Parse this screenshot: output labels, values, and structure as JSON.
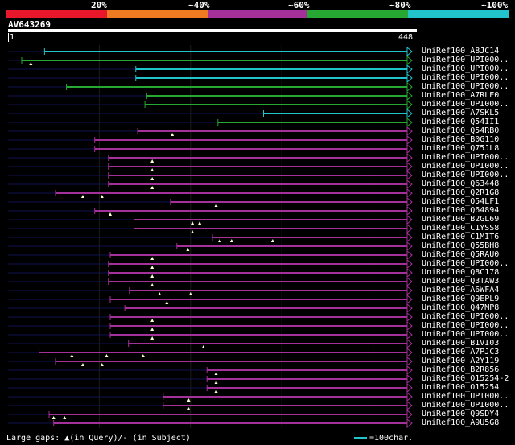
{
  "scale": {
    "ticks": [
      "20%",
      "~40%",
      "~60%",
      "~80%",
      "~100%"
    ],
    "colors": [
      "#e8172b",
      "#ee7b22",
      "#a43099",
      "#26a833",
      "#22c4cc"
    ]
  },
  "query": {
    "name": "AV643269",
    "start": "1",
    "end": "448",
    "length": 448
  },
  "legend": {
    "prefix": "Large gaps: ",
    "query_text": "(in Query)/- (in Subject)",
    "scale_text": "=100char."
  },
  "hits": [
    {
      "name": "UniRef100_A8JC14",
      "start": 40,
      "end": 465,
      "color": "cyan",
      "tri": []
    },
    {
      "name": "UniRef100_UPI000..",
      "start": 15,
      "end": 500,
      "color": "green",
      "tri": [
        25
      ]
    },
    {
      "name": "UniRef100_UPI000..",
      "start": 140,
      "end": 500,
      "color": "cyan",
      "tri": []
    },
    {
      "name": "UniRef100_UPI000..",
      "start": 140,
      "end": 500,
      "color": "cyan",
      "tri": []
    },
    {
      "name": "UniRef100_UPI000..",
      "start": 64,
      "end": 500,
      "color": "green",
      "tri": []
    },
    {
      "name": "UniRef100_A7RLE0",
      "start": 152,
      "end": 500,
      "color": "green",
      "tri": []
    },
    {
      "name": "UniRef100_UPI000..",
      "start": 150,
      "end": 500,
      "color": "green",
      "tri": []
    },
    {
      "name": "UniRef100_A7SKL5",
      "start": 280,
      "end": 500,
      "color": "cyan",
      "tri": []
    },
    {
      "name": "UniRef100_Q54II1",
      "start": 230,
      "end": 500,
      "color": "green",
      "tri": []
    },
    {
      "name": "UniRef100_Q54RB0",
      "start": 142,
      "end": 500,
      "color": "purple",
      "tri": [
        180
      ]
    },
    {
      "name": "UniRef100_B0G110",
      "start": 95,
      "end": 500,
      "color": "purple",
      "tri": []
    },
    {
      "name": "UniRef100_Q75JL8",
      "start": 95,
      "end": 500,
      "color": "purple",
      "tri": []
    },
    {
      "name": "UniRef100_UPI000..",
      "start": 110,
      "end": 500,
      "color": "purple",
      "tri": [
        158
      ]
    },
    {
      "name": "UniRef100_UPI000..",
      "start": 110,
      "end": 500,
      "color": "purple",
      "tri": [
        158
      ]
    },
    {
      "name": "UniRef100_UPI000..",
      "start": 110,
      "end": 500,
      "color": "purple",
      "tri": [
        158
      ]
    },
    {
      "name": "UniRef100_Q63448",
      "start": 110,
      "end": 500,
      "color": "purple",
      "tri": [
        158
      ]
    },
    {
      "name": "UniRef100_Q2R1G8",
      "start": 52,
      "end": 500,
      "color": "purple",
      "tri": [
        82,
        103
      ]
    },
    {
      "name": "UniRef100_Q54LF1",
      "start": 178,
      "end": 500,
      "color": "purple",
      "tri": [
        228
      ]
    },
    {
      "name": "UniRef100_Q64894",
      "start": 95,
      "end": 500,
      "color": "purple",
      "tri": [
        112
      ]
    },
    {
      "name": "UniRef100_B2GL69",
      "start": 138,
      "end": 500,
      "color": "purple",
      "tri": [
        202,
        210
      ]
    },
    {
      "name": "UniRef100_C1YSS8",
      "start": 138,
      "end": 500,
      "color": "purple",
      "tri": [
        202
      ]
    },
    {
      "name": "UniRef100_C1MIT6",
      "start": 224,
      "end": 500,
      "color": "purple",
      "tri": [
        232,
        245,
        290
      ]
    },
    {
      "name": "UniRef100_Q55BH8",
      "start": 185,
      "end": 500,
      "color": "purple",
      "tri": [
        197
      ]
    },
    {
      "name": "UniRef100_Q5RAU0",
      "start": 112,
      "end": 500,
      "color": "purple",
      "tri": [
        158
      ]
    },
    {
      "name": "UniRef100_UPI000..",
      "start": 110,
      "end": 500,
      "color": "purple",
      "tri": [
        158
      ]
    },
    {
      "name": "UniRef100_Q8C178",
      "start": 110,
      "end": 500,
      "color": "purple",
      "tri": [
        158
      ]
    },
    {
      "name": "UniRef100_Q3TAW3",
      "start": 110,
      "end": 500,
      "color": "purple",
      "tri": [
        158
      ]
    },
    {
      "name": "UniRef100_A6WFA4",
      "start": 133,
      "end": 500,
      "color": "purple",
      "tri": [
        166,
        200
      ]
    },
    {
      "name": "UniRef100_Q9EPL9",
      "start": 112,
      "end": 500,
      "color": "purple",
      "tri": [
        174
      ]
    },
    {
      "name": "UniRef100_Q47MP8",
      "start": 128,
      "end": 500,
      "color": "purple",
      "tri": []
    },
    {
      "name": "UniRef100_UPI000..",
      "start": 112,
      "end": 500,
      "color": "purple",
      "tri": [
        158
      ]
    },
    {
      "name": "UniRef100_UPI000..",
      "start": 112,
      "end": 500,
      "color": "purple",
      "tri": [
        158
      ]
    },
    {
      "name": "UniRef100_UPI000..",
      "start": 112,
      "end": 500,
      "color": "purple",
      "tri": [
        158
      ]
    },
    {
      "name": "UniRef100_B1VI03",
      "start": 132,
      "end": 500,
      "color": "purple",
      "tri": [
        214
      ]
    },
    {
      "name": "UniRef100_A7PJC3",
      "start": 34,
      "end": 500,
      "color": "purple",
      "tri": [
        70,
        108,
        148
      ]
    },
    {
      "name": "UniRef100_A2Y119",
      "start": 52,
      "end": 500,
      "color": "purple",
      "tri": [
        82,
        103
      ]
    },
    {
      "name": "UniRef100_B2R856",
      "start": 218,
      "end": 500,
      "color": "purple",
      "tri": [
        228
      ]
    },
    {
      "name": "UniRef100_O15254-2",
      "start": 218,
      "end": 500,
      "color": "purple",
      "tri": [
        228
      ]
    },
    {
      "name": "UniRef100_O15254",
      "start": 218,
      "end": 500,
      "color": "purple",
      "tri": [
        228
      ]
    },
    {
      "name": "UniRef100_UPI000..",
      "start": 170,
      "end": 500,
      "color": "purple",
      "tri": [
        198
      ]
    },
    {
      "name": "UniRef100_UPI000..",
      "start": 170,
      "end": 500,
      "color": "purple",
      "tri": [
        198
      ]
    },
    {
      "name": "UniRef100_Q9SDY4",
      "start": 45,
      "end": 500,
      "color": "purple",
      "tri": [
        50,
        62
      ]
    },
    {
      "name": "UniRef100_A9U5G8",
      "start": 50,
      "end": 500,
      "color": "purple",
      "tri": []
    }
  ]
}
